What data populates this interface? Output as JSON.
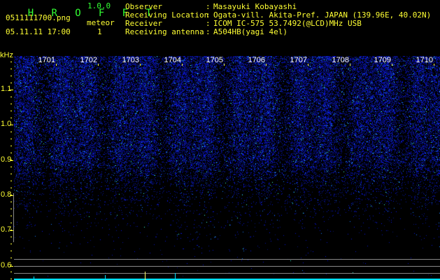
{
  "app": {
    "name_letters": [
      "H",
      "R",
      "O",
      "F",
      "F",
      "T"
    ],
    "version": "1.0.0"
  },
  "file": {
    "name": "0511111700.png",
    "datetime": "05.11.11 17:00"
  },
  "meteor": {
    "label": "meteor",
    "count": "1"
  },
  "info": [
    {
      "label": "Observer",
      "value": "Masayuki Kobayashi"
    },
    {
      "label": "Receiving Location",
      "value": "Ogata-vill. Akita-Pref. JAPAN (139.96E, 40.02N)"
    },
    {
      "label": "Receiver",
      "value": "ICOM IC-575 53.7492(@LCD)MHz USB"
    },
    {
      "label": "Receiving antenna",
      "value": "A504HB(yagi 4el)"
    }
  ],
  "spectrogram": {
    "y_unit": "kHz",
    "y_ticks": [
      "1.1",
      "1.0",
      "0.9",
      "0.8",
      "0.7",
      "0.6"
    ],
    "time_labels": [
      "1701",
      "1702",
      "1703",
      "1704",
      "1705",
      "1706",
      "1707",
      "1708",
      "1709",
      "1710"
    ],
    "colors": {
      "background": "#000000",
      "signal": "#1030ff",
      "strong": "#30ffff",
      "axis": "#ffff33",
      "baseline": "#00e0ff"
    }
  }
}
